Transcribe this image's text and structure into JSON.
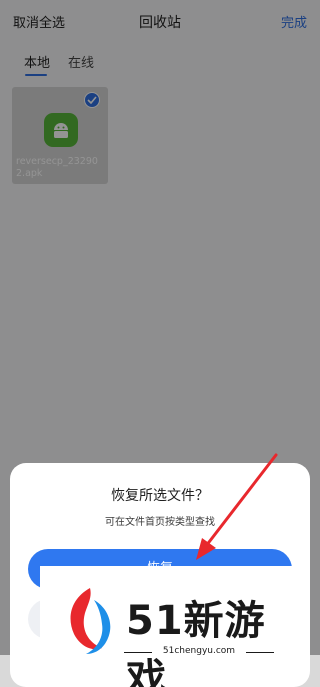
{
  "header": {
    "left_label": "取消全选",
    "title": "回收站",
    "right_label": "完成"
  },
  "tabs": [
    {
      "label": "本地",
      "active": true
    },
    {
      "label": "在线",
      "active": false
    }
  ],
  "files": [
    {
      "name": "reversecp_232902.apk",
      "type": "android-apk-icon",
      "selected": true
    }
  ],
  "dialog": {
    "title": "恢复所选文件？",
    "subtitle": "可在文件首页按类型查找",
    "confirm_label": "恢复"
  },
  "bottom_bar": {
    "label": "恢复"
  },
  "watermark": {
    "brand": "51新游戏",
    "url": "51chengyu.com"
  },
  "colors": {
    "accent": "#2f78f0",
    "link": "#2f6fe0",
    "apk_green": "#57b63a",
    "arrow_red": "#e8282d"
  }
}
